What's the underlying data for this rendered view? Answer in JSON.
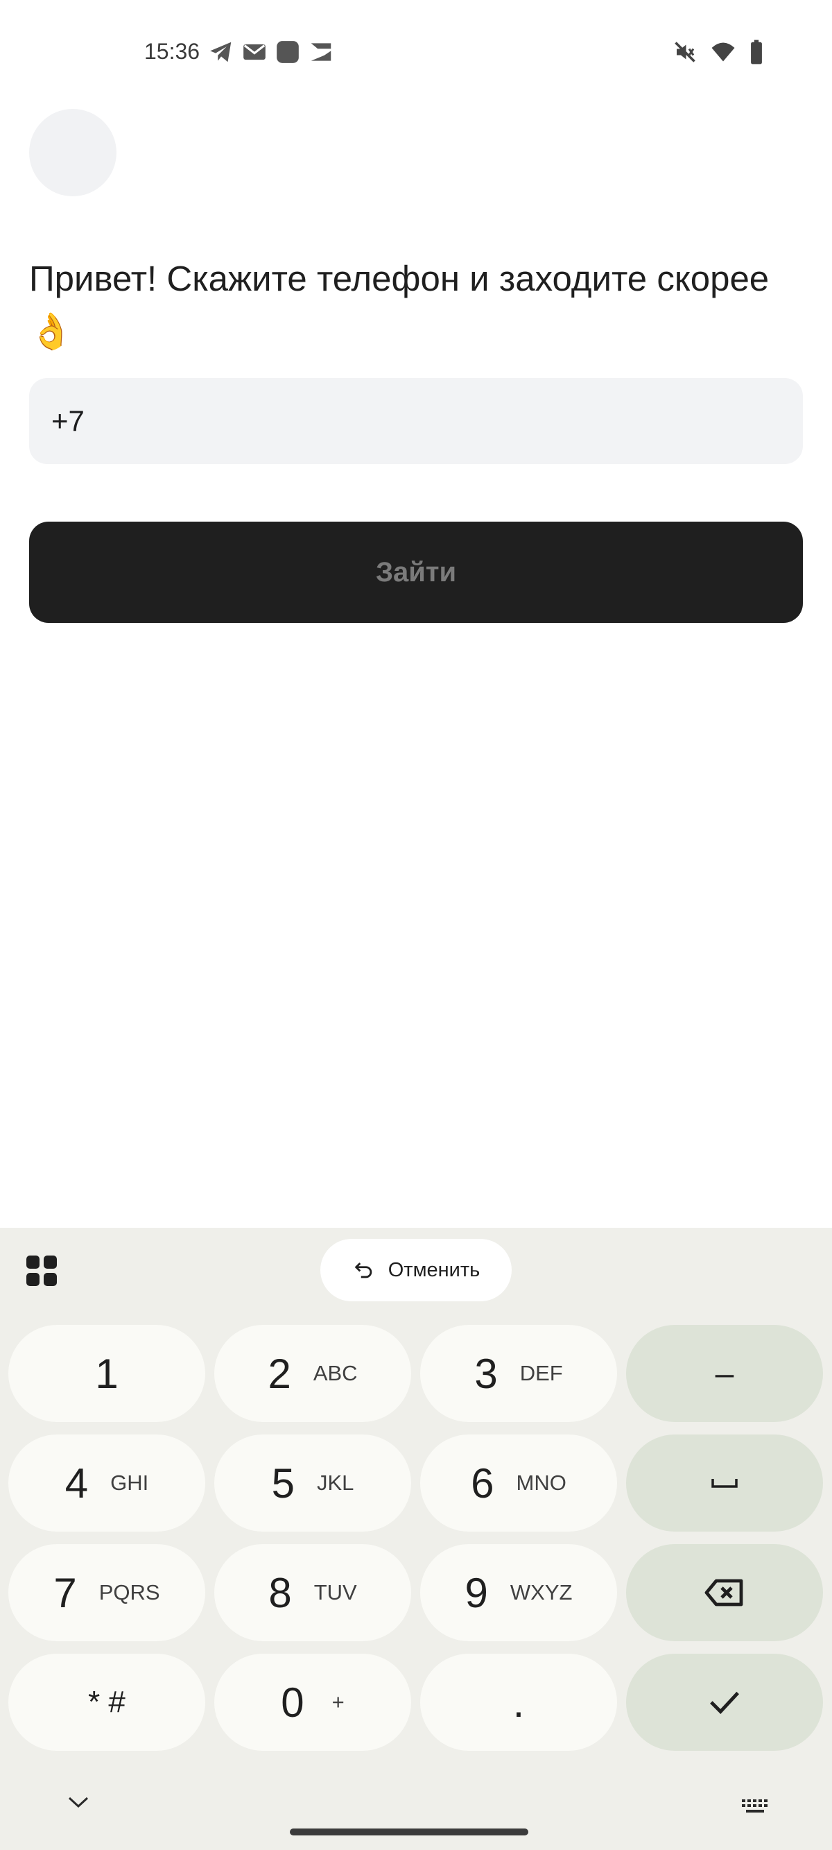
{
  "status_bar": {
    "time": "15:36",
    "notification_icons": [
      "telegram-icon",
      "mail-icon",
      "app-square-icon",
      "app-logo-icon"
    ],
    "system_icons": [
      "mute-icon",
      "wifi-icon",
      "battery-icon"
    ]
  },
  "login": {
    "greeting": "Привет! Скажите телефон и заходите скорее 👌",
    "phone_value": "+7",
    "submit_label": "Зайти"
  },
  "keyboard": {
    "undo_label": "Отменить",
    "keys": [
      {
        "main": "1",
        "sub": ""
      },
      {
        "main": "2",
        "sub": "ABC"
      },
      {
        "main": "3",
        "sub": "DEF"
      },
      {
        "main": "4",
        "sub": "GHI"
      },
      {
        "main": "5",
        "sub": "JKL"
      },
      {
        "main": "6",
        "sub": "MNO"
      },
      {
        "main": "7",
        "sub": "PQRS"
      },
      {
        "main": "8",
        "sub": "TUV"
      },
      {
        "main": "9",
        "sub": "WXYZ"
      },
      {
        "main": "* #",
        "sub": ""
      },
      {
        "main": "0",
        "sub": "+"
      },
      {
        "main": ".",
        "sub": ""
      }
    ],
    "fn_keys": {
      "minus": "–"
    }
  },
  "colors": {
    "button_bg": "#1f1f1f",
    "button_text": "#7b7b7b",
    "field_bg": "#f2f3f5",
    "keyboard_bg": "#efefea",
    "key_bg": "#fafaf6",
    "fn_key_bg": "#dde3d7"
  }
}
